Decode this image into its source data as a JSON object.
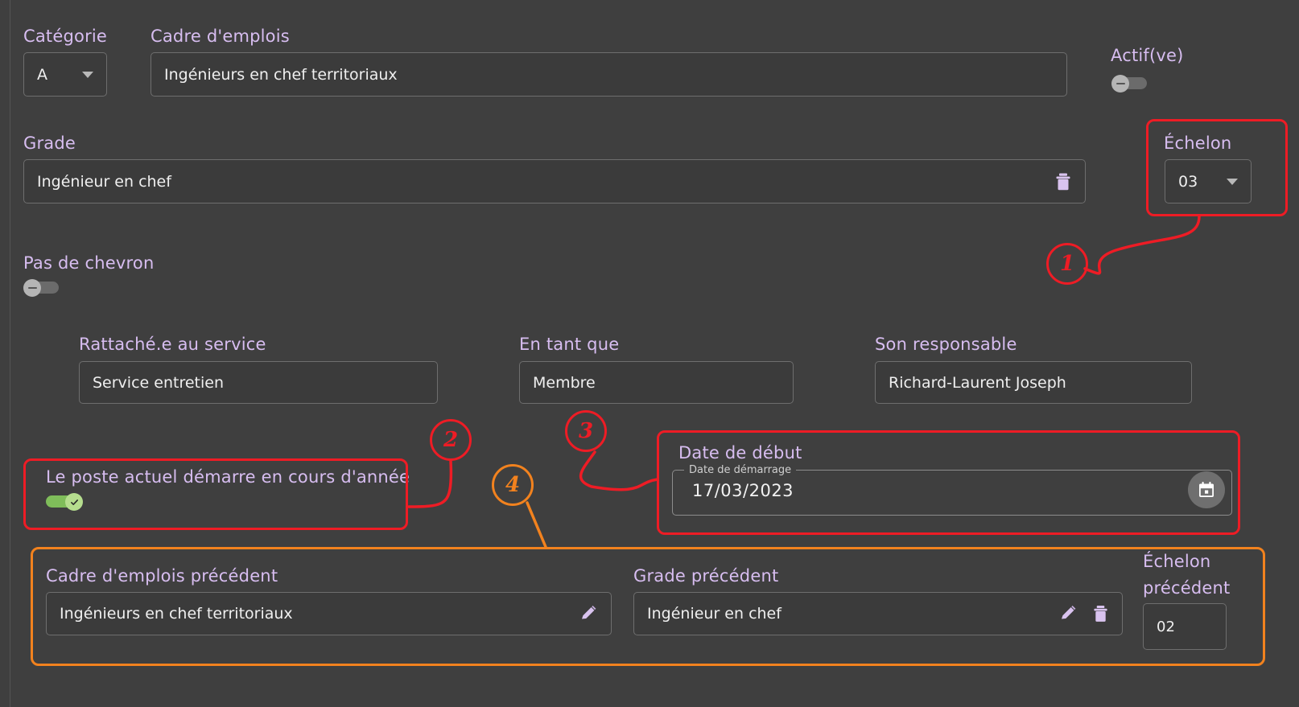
{
  "form": {
    "categorie": {
      "label": "Catégorie",
      "value": "A"
    },
    "cadre_emplois": {
      "label": "Cadre d'emplois",
      "value": "Ingénieurs en chef territoriaux"
    },
    "actif": {
      "label": "Actif(ve)",
      "state": "off"
    },
    "grade": {
      "label": "Grade",
      "value": "Ingénieur en chef",
      "delete_icon": "trash-icon"
    },
    "echelon": {
      "label": "Échelon",
      "value": "03"
    },
    "pas_de_chevron": {
      "label": "Pas de chevron",
      "state": "off"
    },
    "rattache_service": {
      "label": "Rattaché.e au service",
      "value": "Service entretien"
    },
    "en_tant_que": {
      "label": "En tant que",
      "value": "Membre"
    },
    "son_responsable": {
      "label": "Son responsable",
      "value": "Richard-Laurent Joseph"
    },
    "poste_en_cours": {
      "label": "Le poste actuel démarre en cours d'année",
      "state": "on"
    },
    "date_debut": {
      "label": "Date de début",
      "legend": "Date de démarrage",
      "value": "17/03/2023",
      "button_icon": "calendar-icon"
    },
    "cadre_emplois_precedent": {
      "label": "Cadre d'emplois précédent",
      "value": "Ingénieurs en chef territoriaux",
      "edit_icon": "pencil-icon"
    },
    "grade_precedent": {
      "label": "Grade précédent",
      "value": "Ingénieur en chef",
      "edit_icon": "pencil-icon",
      "delete_icon": "trash-icon"
    },
    "echelon_precedent": {
      "label_line1": "Échelon",
      "label_line2": "précédent",
      "value": "02"
    }
  },
  "annotations": {
    "colors": {
      "red": "#ee1c25",
      "orange": "#f2821e"
    },
    "callouts": [
      {
        "number": "1",
        "color": "red"
      },
      {
        "number": "2",
        "color": "red"
      },
      {
        "number": "3",
        "color": "red"
      },
      {
        "number": "4",
        "color": "orange"
      }
    ]
  },
  "theme": {
    "background": "#3f3f3f",
    "label_color": "#d7bdf0",
    "field_background": "#3b3b3b",
    "field_border": "#6e6e6e",
    "toggle_on_color": "#7fbd5a"
  }
}
